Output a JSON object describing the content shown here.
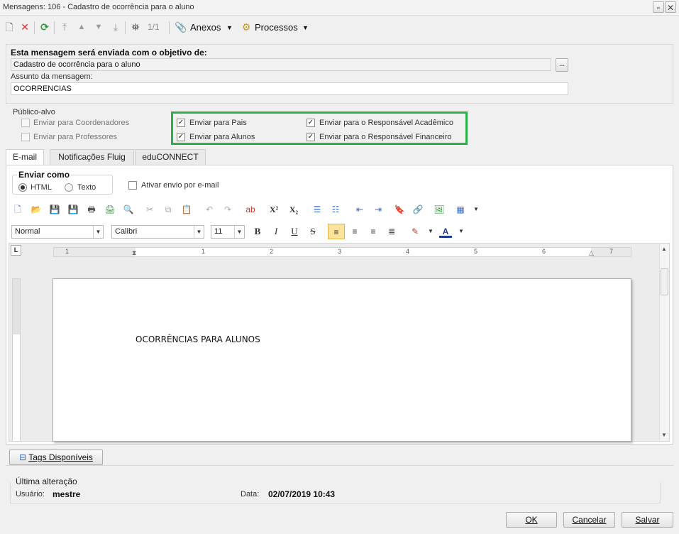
{
  "window": {
    "title": "Mensagens: 106 - Cadastro de ocorrência para o aluno"
  },
  "toolbar": {
    "page_indicator": "1/1",
    "anexos_label": "Anexos",
    "processos_label": "Processos"
  },
  "objective": {
    "heading": "Esta mensagem será enviada com o objetivo de:",
    "value": "Cadastro de ocorrência para o aluno",
    "browse_label": "...",
    "subject_label": "Assunto da mensagem:",
    "subject_value": "OCORRENCIAS"
  },
  "audience": {
    "legend": "Público-alvo",
    "coordenadores": "Enviar para Coordenadores",
    "professores": "Enviar para Professores",
    "pais": "Enviar para Pais",
    "alunos": "Enviar para Alunos",
    "resp_academico": "Enviar para o Responsável Acadêmico",
    "resp_financeiro": "Enviar para o Responsável Financeiro",
    "checked": "✓"
  },
  "tabs": [
    "E-mail",
    "Notificações Fluig",
    "eduCONNECT"
  ],
  "email": {
    "send_as_legend": "Enviar como",
    "html_label": "HTML",
    "text_label": "Texto",
    "activate_label": "Ativar envio por e-mail"
  },
  "editor": {
    "style": "Normal",
    "font": "Calibri",
    "size": "11",
    "bold": "B",
    "italic": "I",
    "underline": "U",
    "strike": "S",
    "superscript": "X²",
    "subscript": "X₂",
    "ruler_corner": "L",
    "ruler_numbers": [
      "1",
      "1",
      "2",
      "3",
      "4",
      "5",
      "6",
      "7"
    ],
    "content": "OCORRÊNCIAS PARA ALUNOS"
  },
  "footer": {
    "tags_label": "Tags Disponíveis",
    "last_change": "Última alteração",
    "user_label": "Usuário:",
    "user_value": "mestre",
    "date_label": "Data:",
    "date_value": "02/07/2019 10:43",
    "ok": "OK",
    "cancel": "Cancelar",
    "save": "Salvar"
  },
  "colors": {
    "highlight": "#2bb04a",
    "danger": "#d8302b",
    "refresh": "#2f9a3a"
  }
}
